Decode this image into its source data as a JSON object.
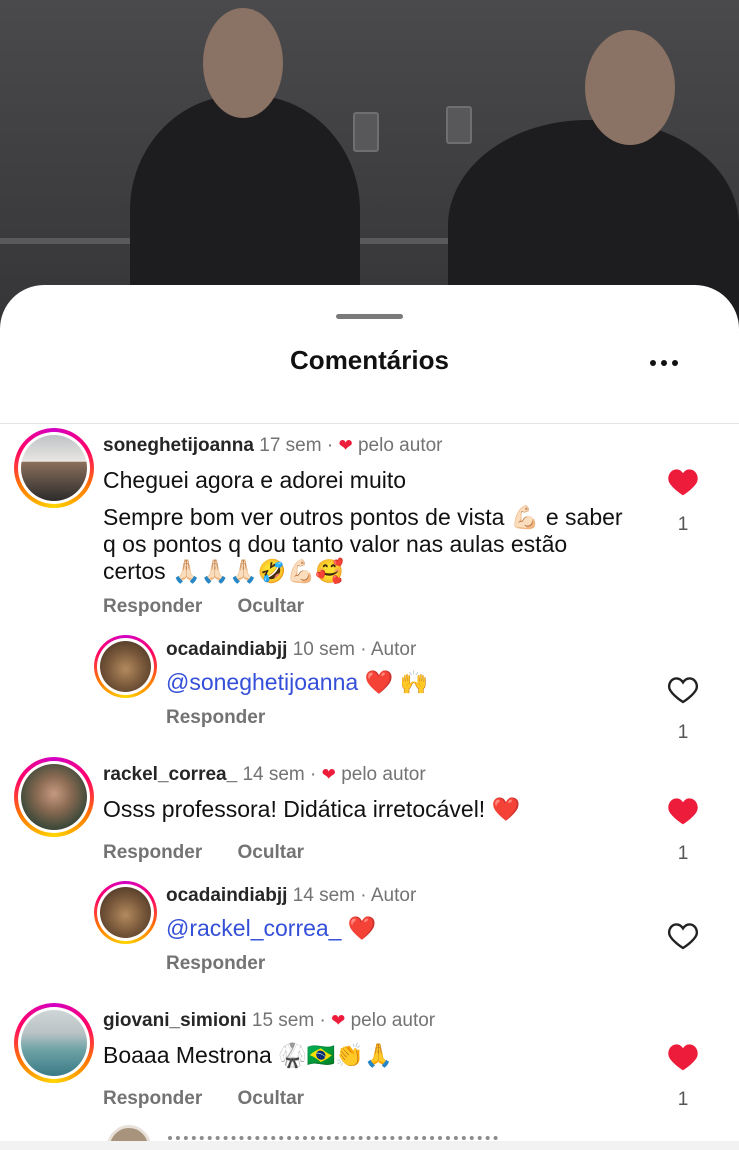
{
  "sheet": {
    "title": "Comentários",
    "more_icon": "more-horizontal-icon"
  },
  "colors": {
    "liked": "#ed1c3b",
    "mention": "#3550d8",
    "secondary": "#737373"
  },
  "comments": [
    {
      "username": "soneghetijoanna",
      "time": "17 sem",
      "sep": "·",
      "badge": "pelo autor",
      "lines": [
        "Cheguei agora e adorei muito",
        "Sempre bom ver outros pontos de vista 💪🏻 e saber q os pontos q dou tanto valor nas aulas estão certos 🙏🏻🙏🏻🙏🏻🤣💪🏻🥰"
      ],
      "reply": "Responder",
      "hide": "Ocultar",
      "liked": true,
      "likes": "1"
    },
    {
      "username": "ocadaindiabjj",
      "time": "10 sem",
      "sep": "·",
      "badge": "Autor",
      "mention": "@soneghetijoanna",
      "after": " ❤️ 🙌",
      "reply": "Responder",
      "liked": false,
      "likes": "1"
    },
    {
      "username": "rackel_correa_",
      "time": "14 sem",
      "sep": "·",
      "badge": "pelo autor",
      "text": "Osss professora! Didática irretocável! ❤️",
      "reply": "Responder",
      "hide": "Ocultar",
      "liked": true,
      "likes": "1"
    },
    {
      "username": "ocadaindiabjj",
      "time": "14 sem",
      "sep": "·",
      "badge": "Autor",
      "mention": "@rackel_correa_",
      "after": " ❤️",
      "reply": "Responder",
      "liked": false
    },
    {
      "username": "giovani_simioni",
      "time": "15 sem",
      "sep": "·",
      "badge": "pelo autor",
      "text": "Boaaa Mestrona 🥋🇧🇷👏🙏",
      "reply": "Responder",
      "hide": "Ocultar",
      "liked": true,
      "likes": "1"
    }
  ]
}
